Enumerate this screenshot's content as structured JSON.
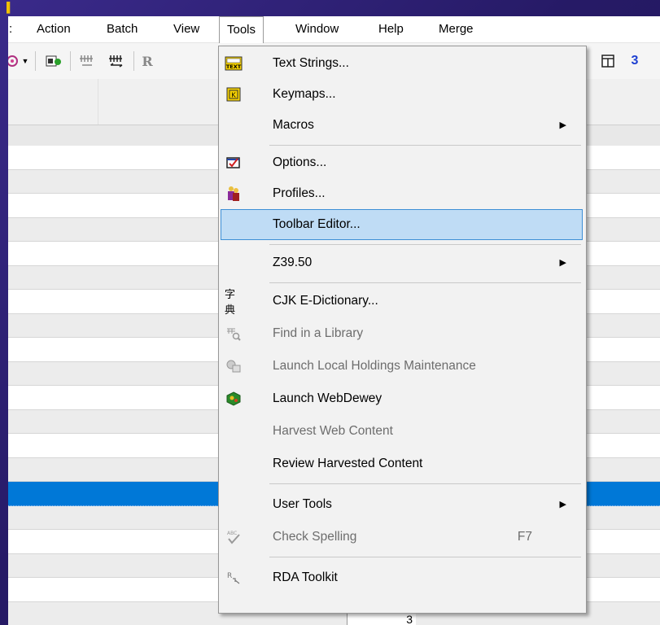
{
  "menubar": {
    "items": [
      {
        "label": "Action"
      },
      {
        "label": "Batch"
      },
      {
        "label": "View"
      },
      {
        "label": "Tools"
      },
      {
        "label": "Window"
      },
      {
        "label": "Help"
      },
      {
        "label": "Merge"
      }
    ],
    "open_menu": "Tools"
  },
  "toolbar": {
    "text_button": "R",
    "right_number": "3"
  },
  "tools_menu": {
    "items": [
      {
        "label": "Text Strings...",
        "icon": "text-strings-icon",
        "enabled": true
      },
      {
        "label": "Keymaps...",
        "icon": "keymaps-icon",
        "enabled": true
      },
      {
        "label": "Macros",
        "submenu": true,
        "enabled": true
      },
      {
        "label": "Options...",
        "icon": "options-icon",
        "enabled": true
      },
      {
        "label": "Profiles...",
        "icon": "profiles-icon",
        "enabled": true
      },
      {
        "label": "Toolbar Editor...",
        "enabled": true,
        "highlighted": true
      },
      {
        "label": "Z39.50",
        "submenu": true,
        "enabled": true
      },
      {
        "label": "CJK E-Dictionary...",
        "icon": "cjk-dictionary-icon",
        "enabled": true
      },
      {
        "label": "Find in a Library",
        "icon": "find-library-icon",
        "enabled": false
      },
      {
        "label": "Launch Local Holdings Maintenance",
        "icon": "holdings-icon",
        "enabled": false
      },
      {
        "label": "Launch WebDewey",
        "icon": "webdewey-icon",
        "enabled": true
      },
      {
        "label": "Harvest Web Content",
        "enabled": false
      },
      {
        "label": "Review Harvested Content",
        "enabled": true
      },
      {
        "label": "User Tools",
        "submenu": true,
        "enabled": true
      },
      {
        "label": "Check Spelling",
        "icon": "spellcheck-icon",
        "shortcut": "F7",
        "enabled": false
      },
      {
        "label": "RDA Toolkit",
        "icon": "rda-icon",
        "enabled": true
      }
    ],
    "icon_glyphs": {
      "text_strings": "TEXT",
      "keymaps": "K",
      "cjk": "字典",
      "rda": "R"
    }
  },
  "grid": {
    "cell_value": "3"
  },
  "colors": {
    "highlight": "#bfdcf5",
    "highlight_border": "#3d8fd6",
    "selection": "#0078d7",
    "background_frame": "#2a1a6e"
  }
}
